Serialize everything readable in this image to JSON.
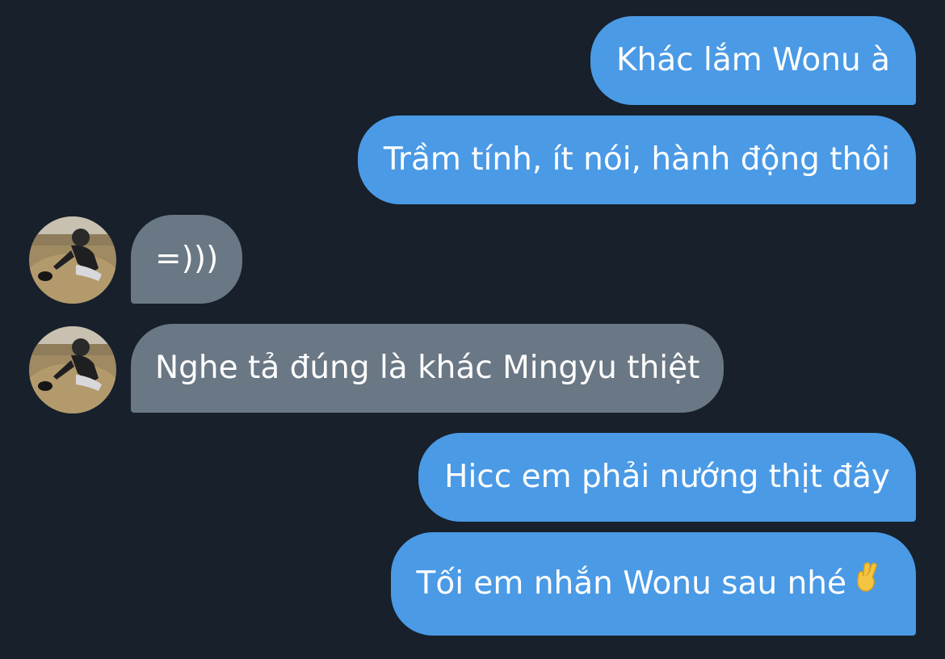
{
  "conversation": {
    "messages": [
      {
        "direction": "sent",
        "text": "Khác lắm Wonu à"
      },
      {
        "direction": "sent",
        "text": "Trầm tính, ít nói, hành động thôi"
      },
      {
        "direction": "received",
        "text": "=)))"
      },
      {
        "direction": "received",
        "text": "Nghe tả đúng là khác Mingyu thiệt"
      },
      {
        "direction": "sent",
        "text": "Hicc em phải nướng thịt đây"
      },
      {
        "direction": "sent",
        "text": "Tối em nhắn Wonu sau nhé",
        "emoji": "crossed-fingers-emoji"
      }
    ]
  },
  "colors": {
    "background": "#17202b",
    "sent_bubble": "#4a9ae6",
    "received_bubble": "#6a7784",
    "text": "#ffffff"
  }
}
